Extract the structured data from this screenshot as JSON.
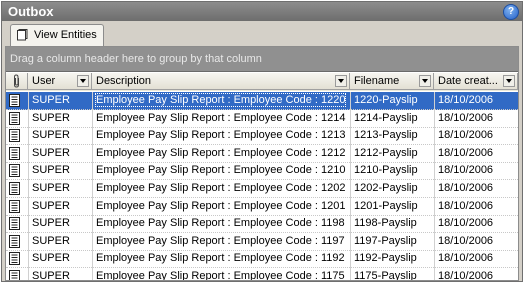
{
  "window": {
    "title": "Outbox",
    "help_glyph": "?"
  },
  "tabs": [
    {
      "label": "View Entities"
    }
  ],
  "group_by_hint": "Drag a column header here to group by that column",
  "columns": [
    {
      "id": "attach",
      "label": ""
    },
    {
      "id": "user",
      "label": "User"
    },
    {
      "id": "description",
      "label": "Description"
    },
    {
      "id": "filename",
      "label": "Filename"
    },
    {
      "id": "date",
      "label": "Date creat..."
    }
  ],
  "selected_row": 0,
  "rows": [
    {
      "user": "SUPER",
      "description": "Employee Pay Slip Report : Employee Code : 1220",
      "filename": "1220-Payslip",
      "date": "18/10/2006"
    },
    {
      "user": "SUPER",
      "description": "Employee Pay Slip Report : Employee Code : 1214",
      "filename": "1214-Payslip",
      "date": "18/10/2006"
    },
    {
      "user": "SUPER",
      "description": "Employee Pay Slip Report : Employee Code : 1213",
      "filename": "1213-Payslip",
      "date": "18/10/2006"
    },
    {
      "user": "SUPER",
      "description": "Employee Pay Slip Report : Employee Code : 1212",
      "filename": "1212-Payslip",
      "date": "18/10/2006"
    },
    {
      "user": "SUPER",
      "description": "Employee Pay Slip Report : Employee Code : 1210",
      "filename": "1210-Payslip",
      "date": "18/10/2006"
    },
    {
      "user": "SUPER",
      "description": "Employee Pay Slip Report : Employee Code : 1202",
      "filename": "1202-Payslip",
      "date": "18/10/2006"
    },
    {
      "user": "SUPER",
      "description": "Employee Pay Slip Report : Employee Code : 1201",
      "filename": "1201-Payslip",
      "date": "18/10/2006"
    },
    {
      "user": "SUPER",
      "description": "Employee Pay Slip Report : Employee Code : 1198",
      "filename": "1198-Payslip",
      "date": "18/10/2006"
    },
    {
      "user": "SUPER",
      "description": "Employee Pay Slip Report : Employee Code : 1197",
      "filename": "1197-Payslip",
      "date": "18/10/2006"
    },
    {
      "user": "SUPER",
      "description": "Employee Pay Slip Report : Employee Code : 1192",
      "filename": "1192-Payslip",
      "date": "18/10/2006"
    },
    {
      "user": "SUPER",
      "description": "Employee Pay Slip Report : Employee Code : 1175",
      "filename": "1175-Payslip",
      "date": "18/10/2006"
    }
  ],
  "icons": {
    "row_icon": "document-icon",
    "attach_icon": "paperclip-icon",
    "tab_icon": "page-icon",
    "help_icon": "help-icon"
  },
  "colors": {
    "selection": "#316ac5",
    "title_bar": "#7d7d7d",
    "group_panel": "#909090"
  }
}
